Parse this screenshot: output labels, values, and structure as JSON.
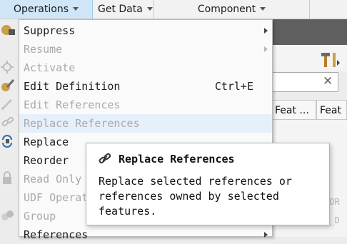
{
  "topbar": {
    "operations": "Operations",
    "get_data": "Get Data",
    "component": "Component"
  },
  "menu": {
    "items": [
      {
        "label": "Suppress",
        "shortcut": "",
        "submenu": true,
        "enabled": true
      },
      {
        "label": "Resume",
        "shortcut": "",
        "submenu": true,
        "enabled": false
      },
      {
        "label": "Activate",
        "shortcut": "",
        "submenu": false,
        "enabled": false
      },
      {
        "label": "Edit Definition",
        "shortcut": "Ctrl+E",
        "submenu": false,
        "enabled": true
      },
      {
        "label": "Edit References",
        "shortcut": "",
        "submenu": false,
        "enabled": false
      },
      {
        "label": "Replace References",
        "shortcut": "",
        "submenu": false,
        "enabled": false,
        "highlighted": true
      },
      {
        "label": "Replace",
        "shortcut": "",
        "submenu": false,
        "enabled": true
      },
      {
        "label": "Reorder",
        "shortcut": "",
        "submenu": false,
        "enabled": true
      },
      {
        "label": "Read Only",
        "shortcut": "",
        "submenu": false,
        "enabled": false
      },
      {
        "label": "UDF Operat",
        "shortcut": "",
        "submenu": false,
        "enabled": false
      },
      {
        "label": "Group",
        "shortcut": "",
        "submenu": false,
        "enabled": false
      },
      {
        "label": "References",
        "shortcut": "",
        "submenu": true,
        "enabled": true
      }
    ]
  },
  "tooltip": {
    "title": "Replace References",
    "description": "Replace selected references or references owned by selected features."
  },
  "background": {
    "col1": "Feat ...",
    "col2": "Feat",
    "faint1": "OOR",
    "faint2": "M_D"
  },
  "colors": {
    "menu_highlight": "#e5f0fb",
    "active_tab": "#cfe6f8",
    "disabled_text": "#a9a9a9"
  }
}
